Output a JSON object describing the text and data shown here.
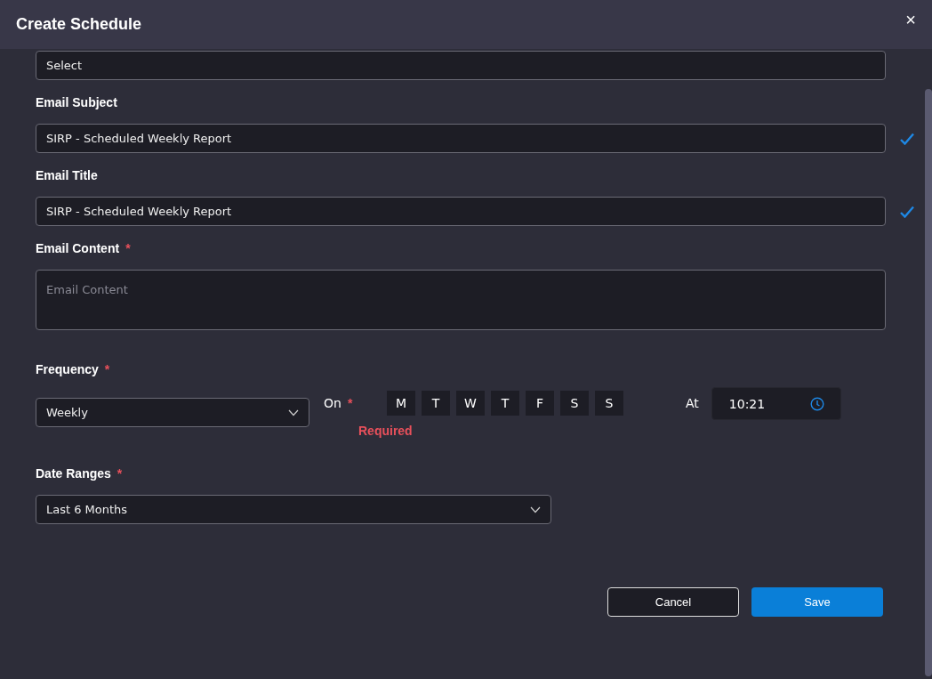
{
  "dialog": {
    "title": "Create Schedule",
    "close": "×"
  },
  "top_select": {
    "value": "Select"
  },
  "fields": [
    {
      "label": "Email Subject",
      "value": "SIRP - Scheduled Weekly Report",
      "valid": true
    },
    {
      "label": "Email Title",
      "value": "SIRP - Scheduled Weekly Report",
      "valid": true
    }
  ],
  "content": {
    "label": "Email Content",
    "required_mark": "*",
    "placeholder": "Email Content"
  },
  "frequency": {
    "label": "Frequency",
    "required_mark": "*",
    "value": "Weekly"
  },
  "on": {
    "label": "On",
    "required_mark": "*",
    "error": "Required",
    "days": [
      {
        "label": "M",
        "selected": false
      },
      {
        "label": "T",
        "selected": false
      },
      {
        "label": "W",
        "selected": false
      },
      {
        "label": "T",
        "selected": false
      },
      {
        "label": "F",
        "selected": false
      },
      {
        "label": "S",
        "selected": false
      },
      {
        "label": "S",
        "selected": false
      }
    ]
  },
  "at": {
    "label": "At",
    "value": "10:21"
  },
  "date_ranges": {
    "label": "Date Ranges",
    "required_mark": "*",
    "value": "Last 6 Months"
  },
  "buttons": [
    {
      "label": "Cancel",
      "kind": "secondary"
    },
    {
      "label": "Save",
      "kind": "primary"
    }
  ]
}
